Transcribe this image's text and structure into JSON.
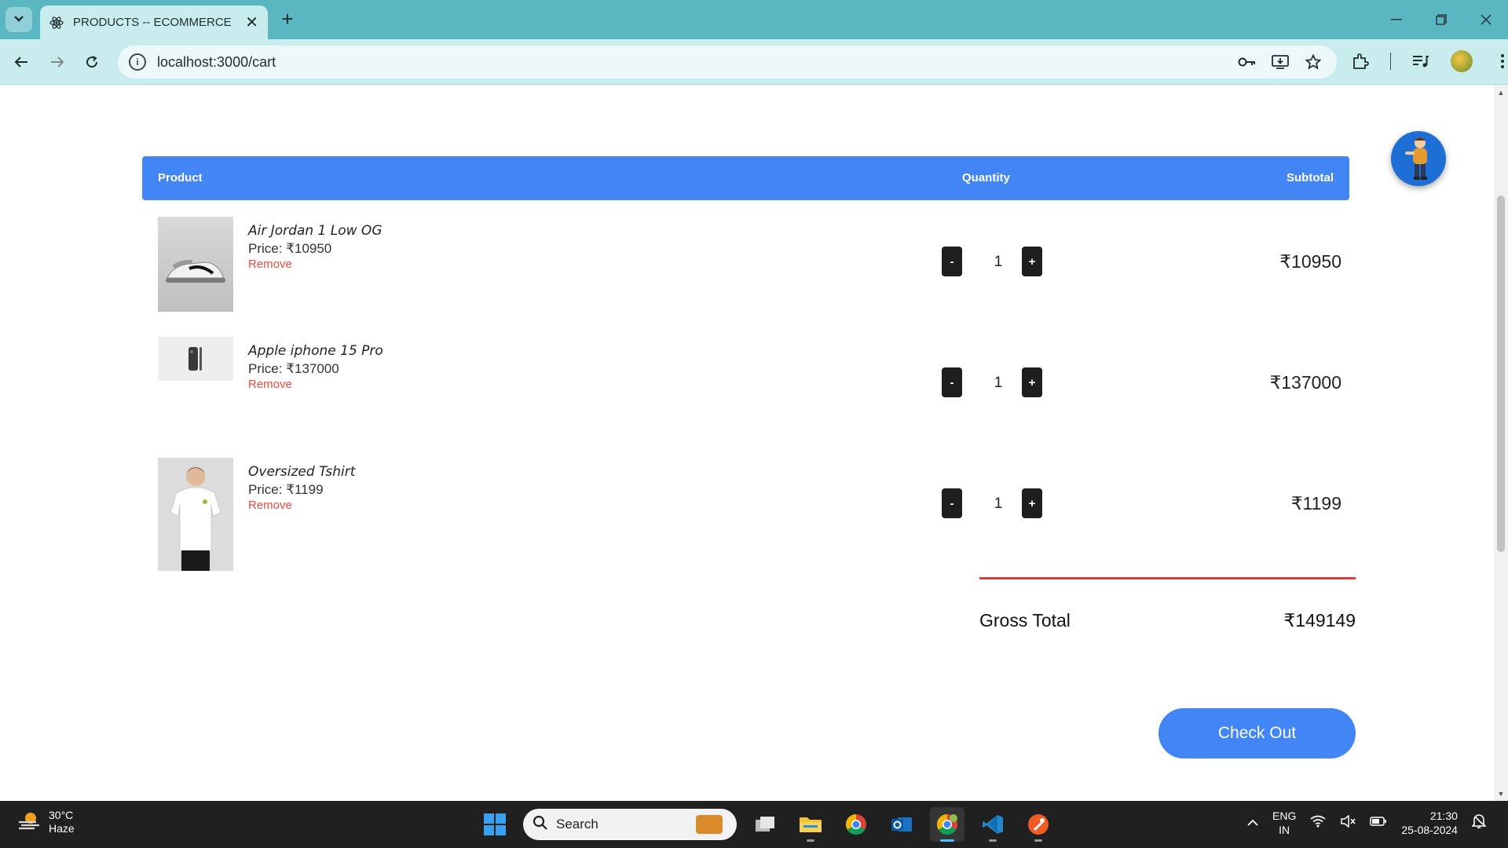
{
  "browser": {
    "tab_title": "PRODUCTS -- ECOMMERCE",
    "url": "localhost:3000/cart"
  },
  "cart": {
    "headers": {
      "product": "Product",
      "quantity": "Quantity",
      "subtotal": "Subtotal"
    },
    "items": [
      {
        "name": "Air Jordan 1 Low OG",
        "price": "Price: ₹10950",
        "remove": "Remove",
        "qty": "1",
        "minus": "-",
        "plus": "+",
        "subtotal": "₹10950"
      },
      {
        "name": "Apple iphone 15 Pro",
        "price": "Price: ₹137000",
        "remove": "Remove",
        "qty": "1",
        "minus": "-",
        "plus": "+",
        "subtotal": "₹137000"
      },
      {
        "name": "Oversized Tshirt",
        "price": "Price: ₹1199",
        "remove": "Remove",
        "qty": "1",
        "minus": "-",
        "plus": "+",
        "subtotal": "₹1199"
      }
    ],
    "gross_label": "Gross Total",
    "gross_value": "₹149149",
    "checkout_label": "Check Out"
  },
  "taskbar": {
    "weather_temp": "30°C",
    "weather_cond": "Haze",
    "search_placeholder": "Search",
    "lang_top": "ENG",
    "lang_bottom": "IN",
    "time": "21:30",
    "date": "25-08-2024"
  },
  "colors": {
    "accent": "#4285f4",
    "remove": "#e84a3f",
    "divider": "#e53935",
    "tabstrip": "#5ab6c1"
  }
}
